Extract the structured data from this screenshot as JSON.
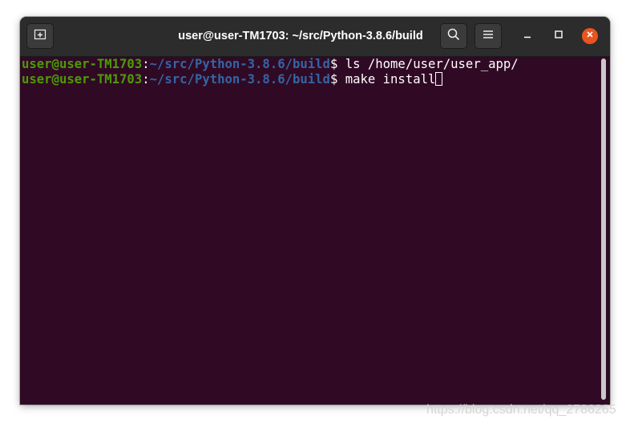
{
  "window": {
    "title": "user@user-TM1703: ~/src/Python-3.8.6/build"
  },
  "toolbar": {
    "new_tab_icon": "new-tab-icon",
    "search_icon": "search-icon",
    "menu_icon": "hamburger-menu-icon",
    "minimize_icon": "minimize-icon",
    "maximize_icon": "maximize-icon",
    "close_icon": "close-icon"
  },
  "terminal": {
    "lines": [
      {
        "user_host": "user@user-TM1703",
        "separator": ":",
        "path": "~/src/Python-3.8.6/build",
        "prompt": "$ ",
        "command": "ls /home/user/user_app/"
      },
      {
        "user_host": "user@user-TM1703",
        "separator": ":",
        "path": "~/src/Python-3.8.6/build",
        "prompt": "$ ",
        "command": "make install"
      }
    ]
  },
  "watermark": "https://blog.csdn.net/qq_2786265",
  "colors": {
    "terminal_bg": "#300a24",
    "titlebar_bg": "#2c2c2c",
    "user_host": "#4e9a06",
    "path": "#3465a4",
    "close_button": "#e95420"
  }
}
